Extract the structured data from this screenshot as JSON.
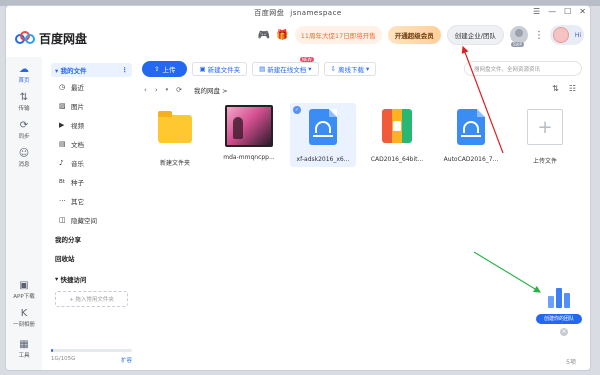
{
  "window": {
    "title": "百度网盘",
    "username": "jsnamespace",
    "controls": [
      "☰",
      "—",
      "☐",
      "✕"
    ]
  },
  "header": {
    "logo_text": "百度网盘",
    "promo_text": "11周年大促17日即将开售",
    "vip_label": "开通超级会员",
    "team_label": "创建企业/团队",
    "avatar_badge": "SVIP",
    "mascot_text": "Hi"
  },
  "rail": [
    {
      "label": "首页",
      "icon": "home-icon",
      "glyph": "☁"
    },
    {
      "label": "传输",
      "icon": "transfer-icon",
      "glyph": "⇅"
    },
    {
      "label": "同步",
      "icon": "sync-icon",
      "glyph": "⟳"
    },
    {
      "label": "消息",
      "icon": "message-icon",
      "glyph": "☺"
    },
    {
      "label": "APP下载",
      "icon": "app-download-icon",
      "glyph": "▣"
    },
    {
      "label": "一刻相册",
      "icon": "album-icon",
      "glyph": "K"
    },
    {
      "label": "工具",
      "icon": "tools-icon",
      "glyph": "▦"
    }
  ],
  "sidebar": {
    "my_files": "我的文件",
    "items": [
      {
        "label": "最近",
        "icon": "clock-icon",
        "glyph": "◷"
      },
      {
        "label": "图片",
        "icon": "image-icon",
        "glyph": "▨"
      },
      {
        "label": "视频",
        "icon": "video-icon",
        "glyph": "▶"
      },
      {
        "label": "文档",
        "icon": "document-icon",
        "glyph": "▤"
      },
      {
        "label": "音乐",
        "icon": "music-icon",
        "glyph": "♪"
      },
      {
        "label": "种子",
        "icon": "bt-icon",
        "glyph": "Bt"
      },
      {
        "label": "其它",
        "icon": "other-icon",
        "glyph": "···"
      },
      {
        "label": "隐藏空间",
        "icon": "hidden-space-icon",
        "glyph": "◫"
      }
    ],
    "my_share": "我的分享",
    "recycle": "回收站",
    "quick_access": "快捷访问",
    "add_quick": "+ 拖入常用文件夹",
    "storage_text": "1G/105G",
    "storage_fraction": 0.01,
    "expand": "扩容"
  },
  "toolbar": {
    "upload": "上传",
    "new_folder": "新建文件夹",
    "new_online_doc": "新建在线文档",
    "new_tag": "NEW",
    "offline_download": "离线下载",
    "search_placeholder": "搜网盘文件、全网资源资讯"
  },
  "nav": {
    "crumb": "我的网盘",
    "crumb_arrow": ">"
  },
  "files": [
    {
      "name": "新建文件夹",
      "type": "folder"
    },
    {
      "name": "mda-mmqncpp...",
      "type": "video"
    },
    {
      "name": "xf-adsk2016_x6...",
      "type": "doc",
      "selected": true
    },
    {
      "name": "CAD2016_64bit...",
      "type": "zip"
    },
    {
      "name": "AutoCAD2016_7...",
      "type": "doc"
    },
    {
      "name": "上传文件",
      "type": "upload"
    }
  ],
  "item_count": "5项",
  "team_float_label": "创建你的团队"
}
